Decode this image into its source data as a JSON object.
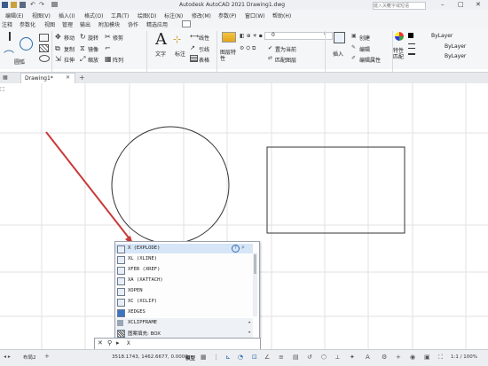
{
  "app": {
    "title": "Autodesk AutoCAD 2021    Drawing1.dwg",
    "search_placeholder": "键入关键字或短语"
  },
  "menu": [
    "编辑(E)",
    "视图(V)",
    "插入(I)",
    "格式(O)",
    "工具(T)",
    "绘图(D)",
    "标注(N)",
    "修改(M)",
    "参数(P)",
    "窗口(W)",
    "帮助(H)"
  ],
  "ribbon_tabs": [
    "注释",
    "参数化",
    "视图",
    "管理",
    "输出",
    "附加模块",
    "协作",
    "精选应用"
  ],
  "ribbon": {
    "draw": {
      "line": "",
      "circle": "圆弧"
    },
    "modify": {
      "move": "移动",
      "rotate": "旋转",
      "trim": "修剪",
      "copy": "复制",
      "mirror": "镜像",
      "stretch": "拉伸",
      "scale": "缩放",
      "array": "阵列"
    },
    "annotation": {
      "text": "文字",
      "dimension": "标注",
      "linear": "线性",
      "leader": "引线",
      "table": "表格"
    },
    "layers": {
      "properties": "图层特性",
      "layer_name": "0",
      "set_current": "置为当前",
      "match": "匹配图层"
    },
    "block": {
      "insert": "插入",
      "create": "创建",
      "edit": "编辑",
      "edit_attr": "编辑属性"
    },
    "properties": {
      "match": "特性匹配",
      "color": "ByLayer",
      "linetype": "ByLayer",
      "lineweight": "ByLayer"
    }
  },
  "file_tab": "Drawing1*",
  "command_autocomplete": {
    "items": [
      {
        "cmd": "X (EXPLODE)",
        "highlighted": true
      },
      {
        "cmd": "XL (XLINE)",
        "highlighted": false
      },
      {
        "cmd": "XFER (XREF)",
        "highlighted": false
      },
      {
        "cmd": "XA (XATTACH)",
        "highlighted": false
      },
      {
        "cmd": "XOPEN",
        "highlighted": false
      },
      {
        "cmd": "XC (XCLIP)",
        "highlighted": false
      },
      {
        "cmd": "XEDGES",
        "highlighted": false
      },
      {
        "cmd": "XCLIPFRAME",
        "highlighted": false
      },
      {
        "cmd": "图案填充: BOX",
        "highlighted": false
      }
    ]
  },
  "command_line": {
    "input": "X",
    "close": "×"
  },
  "status": {
    "layout_tab": "布局2",
    "coords": "3518.1743, 1462.6677, 0.0000",
    "model": "模型",
    "zoom": "1:1 / 100%"
  }
}
